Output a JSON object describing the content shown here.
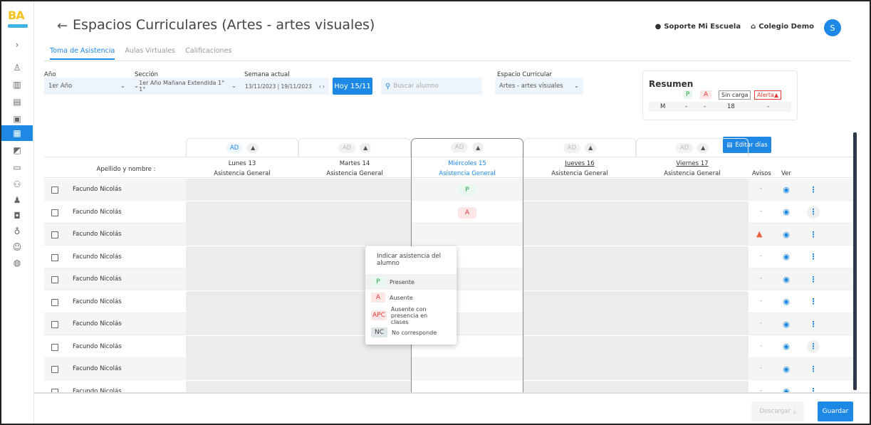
{
  "header": {
    "title": "Espacios Curriculares (Artes - artes visuales)",
    "user": "Soporte Mi Escuela",
    "school": "Colegio Demo",
    "avatar": "S"
  },
  "logo": "BA",
  "tabs": [
    {
      "label": "Toma de Asistencia",
      "active": true
    },
    {
      "label": "Aulas Virtuales",
      "active": false
    },
    {
      "label": "Calificaciones",
      "active": false
    }
  ],
  "filters": {
    "anio": {
      "label": "Año",
      "value": "1er Año"
    },
    "seccion": {
      "label": "Sección",
      "value": "1er Año Mañana Extendida 1° 1°"
    },
    "semana": {
      "label": "Semana actual",
      "value": "13/11/2023 | 19/11/2023"
    },
    "hoy": "Hoy 15/11",
    "search_placeholder": "Buscar alumno",
    "espacio": {
      "label": "Espacio Curricular",
      "value": "Artes - artes visuales"
    }
  },
  "resumen": {
    "title": "Resumen",
    "headers": [
      "P",
      "A",
      "Sin carga",
      "Alerta"
    ],
    "row": [
      "M",
      "-",
      "-",
      "18",
      "-"
    ]
  },
  "editar_dias": "Editar días",
  "table": {
    "name_header": "Apellido y nombre :",
    "avisos": "Avisos",
    "ver": "Ver",
    "day_badge": "AD",
    "days": [
      {
        "day": "Lunes 13",
        "sub": "Asistencia General"
      },
      {
        "day": "Martes 14",
        "sub": "Asistencia General"
      },
      {
        "day": "Miércoles 15",
        "sub": "Asistencia General"
      },
      {
        "day": "Jueves 16",
        "sub": "Asistencia General"
      },
      {
        "day": "Viernes 17",
        "sub": "Asistencia General"
      }
    ],
    "rows": [
      {
        "name": "Facundo Nicolás",
        "att": "P",
        "aviso": "-"
      },
      {
        "name": "Facundo Nicolás",
        "att": "A",
        "aviso": "-"
      },
      {
        "name": "Facundo Nicolás",
        "att": "",
        "aviso": "warn"
      },
      {
        "name": "Facundo Nicolás",
        "att": "",
        "aviso": "-"
      },
      {
        "name": "Facundo Nicolás",
        "att": "",
        "aviso": "-"
      },
      {
        "name": "Facundo Nicolás",
        "att": "",
        "aviso": "-"
      },
      {
        "name": "Facundo Nicolás",
        "att": "",
        "aviso": "-"
      },
      {
        "name": "Facundo Nicolás",
        "att": "",
        "aviso": "-"
      },
      {
        "name": "Facundo Nicolás",
        "att": "",
        "aviso": "-"
      },
      {
        "name": "Facundo Nicolás",
        "att": "",
        "aviso": "-"
      }
    ]
  },
  "dropdown": {
    "title": "Indicar asistencia del alumno",
    "options": [
      {
        "code": "P",
        "label": "Presente"
      },
      {
        "code": "A",
        "label": "Ausente"
      },
      {
        "code": "APC",
        "label": "Ausente con presencia en clases"
      },
      {
        "code": "NC",
        "label": "No corresponde"
      }
    ]
  },
  "footer": {
    "descargar": "Descargar",
    "guardar": "Guardar"
  },
  "colors": {
    "accent": "#1e88e5",
    "present": "#28a745",
    "absent": "#e53935",
    "warning": "#e8603c"
  }
}
